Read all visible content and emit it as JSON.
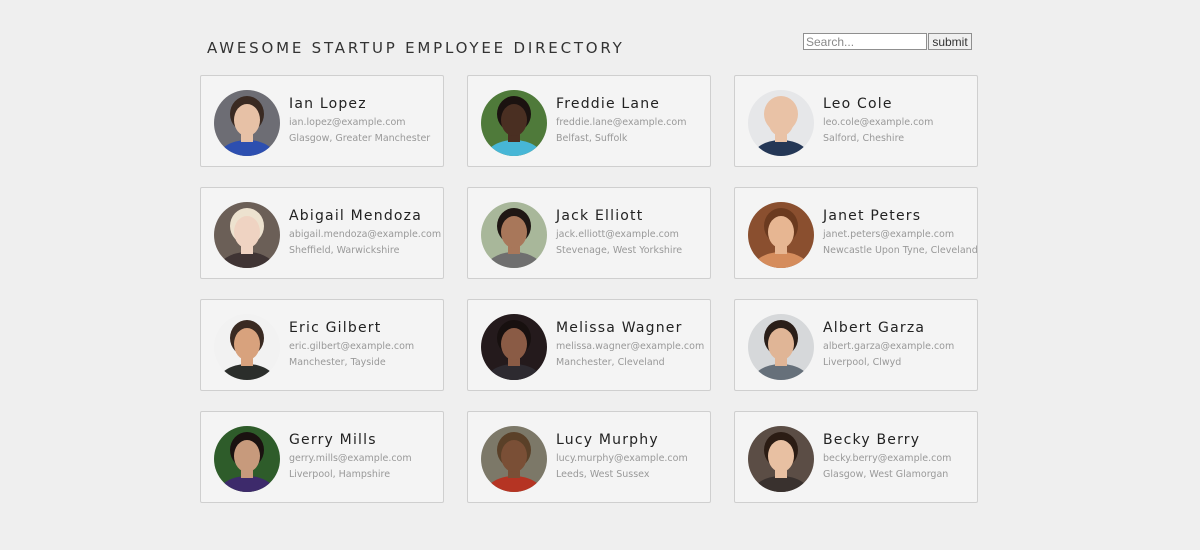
{
  "header": {
    "title": "AWESOME STARTUP EMPLOYEE DIRECTORY"
  },
  "search": {
    "placeholder": "Search...",
    "value": "",
    "submit_label": "submit"
  },
  "employees": [
    {
      "name": "Ian Lopez",
      "email": "ian.lopez@example.com",
      "location": "Glasgow, Greater Manchester",
      "avatar": {
        "bg": "#6d6d74",
        "skin": "#e7c1a6",
        "hair": "#3a2a22",
        "shirt": "#2d4fb0"
      }
    },
    {
      "name": "Freddie Lane",
      "email": "freddie.lane@example.com",
      "location": "Belfast, Suffolk",
      "avatar": {
        "bg": "#4f7a3a",
        "skin": "#4a2f22",
        "hair": "#1b1210",
        "shirt": "#47b6d6"
      }
    },
    {
      "name": "Leo Cole",
      "email": "leo.cole@example.com",
      "location": "Salford, Cheshire",
      "avatar": {
        "bg": "#e6e7e9",
        "skin": "#e9c2a6",
        "hair": "#e9c2a6",
        "shirt": "#243756"
      }
    },
    {
      "name": "Abigail Mendoza",
      "email": "abigail.mendoza@example.com",
      "location": "Sheffield, Warwickshire",
      "avatar": {
        "bg": "#6b5f57",
        "skin": "#efd3c2",
        "hair": "#ede2cf",
        "shirt": "#3f3434"
      }
    },
    {
      "name": "Jack Elliott",
      "email": "jack.elliott@example.com",
      "location": "Stevenage, West Yorkshire",
      "avatar": {
        "bg": "#a8b79a",
        "skin": "#a8775a",
        "hair": "#1f1714",
        "shirt": "#6f6f6f"
      }
    },
    {
      "name": "Janet Peters",
      "email": "janet.peters@example.com",
      "location": "Newcastle Upon Tyne, Cleveland",
      "avatar": {
        "bg": "#8a4f2f",
        "skin": "#e7b692",
        "hair": "#6b3a1f",
        "shirt": "#d58c5c"
      }
    },
    {
      "name": "Eric Gilbert",
      "email": "eric.gilbert@example.com",
      "location": "Manchester, Tayside",
      "avatar": {
        "bg": "#f2f2f2",
        "skin": "#d8a27d",
        "hair": "#3a2a22",
        "shirt": "#2b2e2b"
      }
    },
    {
      "name": "Melissa Wagner",
      "email": "melissa.wagner@example.com",
      "location": "Manchester, Cleveland",
      "avatar": {
        "bg": "#241a1c",
        "skin": "#8a5b45",
        "hair": "#17100f",
        "shirt": "#2d2a30"
      }
    },
    {
      "name": "Albert Garza",
      "email": "albert.garza@example.com",
      "location": "Liverpool, Clwyd",
      "avatar": {
        "bg": "#d6d8da",
        "skin": "#e0b596",
        "hair": "#2a1e18",
        "shirt": "#66707a"
      }
    },
    {
      "name": "Gerry Mills",
      "email": "gerry.mills@example.com",
      "location": "Liverpool, Hampshire",
      "avatar": {
        "bg": "#2e5c2a",
        "skin": "#c79a7c",
        "hair": "#1a1210",
        "shirt": "#3d2a6b"
      }
    },
    {
      "name": "Lucy Murphy",
      "email": "lucy.murphy@example.com",
      "location": "Leeds, West Sussex",
      "avatar": {
        "bg": "#7c7868",
        "skin": "#7a4f36",
        "hair": "#5a4028",
        "shirt": "#b53423"
      }
    },
    {
      "name": "Becky Berry",
      "email": "becky.berry@example.com",
      "location": "Glasgow, West Glamorgan",
      "avatar": {
        "bg": "#5b4d45",
        "skin": "#e8c0a2",
        "hair": "#2b1c14",
        "shirt": "#39312e"
      }
    }
  ]
}
